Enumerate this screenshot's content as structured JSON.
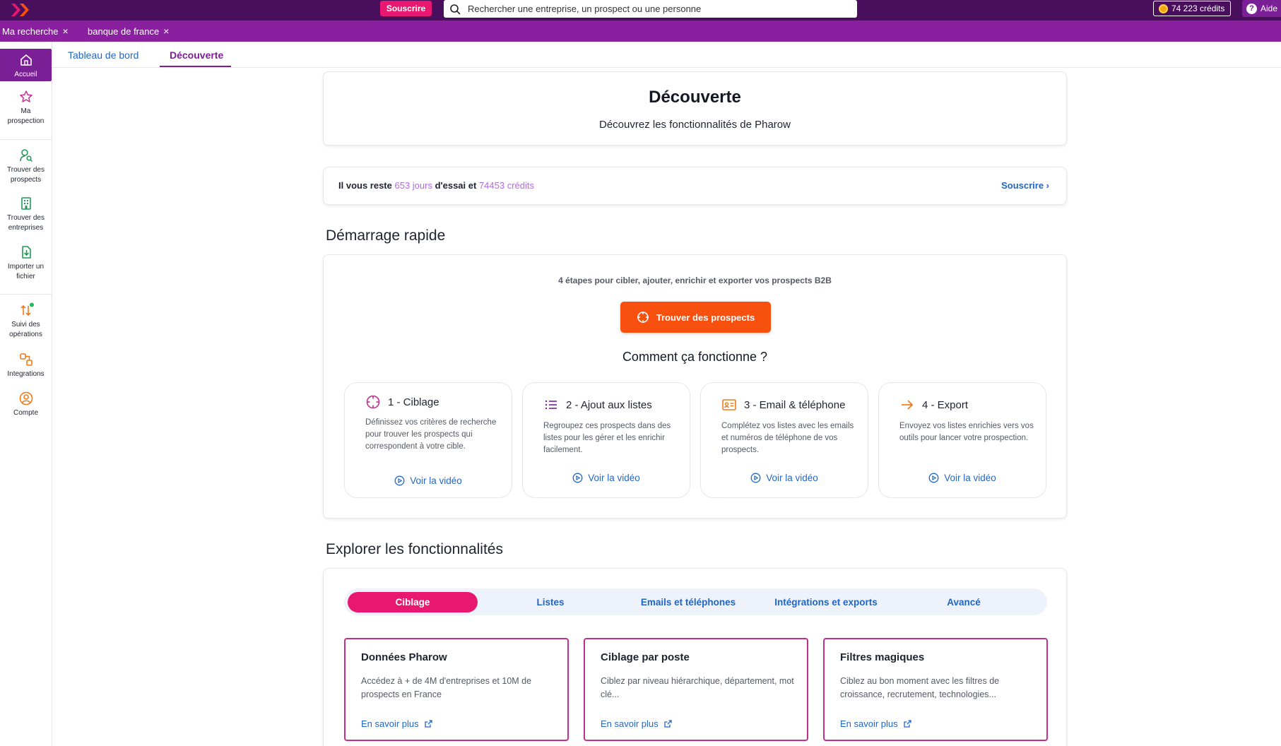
{
  "topbar": {
    "subscribe_label": "Souscrire",
    "search_placeholder": "Rechercher une entreprise, un prospect ou une personne",
    "credits_label": "74 223 crédits",
    "help_label": "Aide"
  },
  "open_tabs": [
    {
      "label": "Ma recherche"
    },
    {
      "label": "banque de france"
    }
  ],
  "sidebar": {
    "items": [
      {
        "label_line1": "Accueil",
        "label_line2": ""
      },
      {
        "label_line1": "Ma",
        "label_line2": "prospection"
      },
      {
        "label_line1": "Trouver des",
        "label_line2": "prospects"
      },
      {
        "label_line1": "Trouver des",
        "label_line2": "entreprises"
      },
      {
        "label_line1": "Importer un",
        "label_line2": "fichier"
      },
      {
        "label_line1": "Suivi des",
        "label_line2": "opérations"
      },
      {
        "label_line1": "Integrations",
        "label_line2": ""
      },
      {
        "label_line1": "Compte",
        "label_line2": ""
      }
    ]
  },
  "subnav": {
    "tabs": [
      {
        "label": "Tableau de bord"
      },
      {
        "label": "Découverte"
      }
    ]
  },
  "hero": {
    "title": "Découverte",
    "subtitle": "Découvrez les fonctionnalités de Pharow"
  },
  "trial": {
    "prefix": "Il vous reste ",
    "days": "653 jours",
    "middle": " d'essai et ",
    "credits": "74453 crédits",
    "link": "Souscrire ›"
  },
  "quickstart": {
    "section_title": "Démarrage rapide",
    "subtitle": "4 étapes pour cibler, ajouter, enrichir et exporter vos prospects B2B",
    "button_label": "Trouver des prospects",
    "how_title": "Comment ça fonctionne ?",
    "steps": [
      {
        "title": "1 - Ciblage",
        "desc": "Définissez vos critères de recherche pour trouver les prospects qui correspondent à votre cible.",
        "link": "Voir la vidéo",
        "icon": "target-icon"
      },
      {
        "title": "2 - Ajout aux listes",
        "desc": "Regroupez ces prospects dans des listes pour les gérer et les enrichir facilement.",
        "link": "Voir la vidéo",
        "icon": "list-icon"
      },
      {
        "title": "3 - Email & téléphone",
        "desc": "Complétez vos listes avec les emails et numéros de téléphone de vos prospects.",
        "link": "Voir la vidéo",
        "icon": "contact-card-icon"
      },
      {
        "title": "4 - Export",
        "desc": "Envoyez vos listes enrichies vers vos outils pour lancer votre prospection.",
        "link": "Voir la vidéo",
        "icon": "arrow-right-icon"
      }
    ]
  },
  "explore": {
    "section_title": "Explorer les fonctionnalités",
    "tabs": [
      {
        "label": "Ciblage"
      },
      {
        "label": "Listes"
      },
      {
        "label": "Emails et téléphones"
      },
      {
        "label": "Intégrations et exports"
      },
      {
        "label": "Avancé"
      }
    ],
    "features": [
      {
        "title": "Données Pharow",
        "desc": "Accédez à + de 4M d'entreprises et 10M de prospects en France",
        "link": "En savoir plus"
      },
      {
        "title": "Ciblage par poste",
        "desc": "Ciblez par niveau hiérarchique, département, mot clé...",
        "link": "En savoir plus"
      },
      {
        "title": "Filtres magiques",
        "desc": "Ciblez au bon moment avec les filtres de croissance, recrutement, technologies...",
        "link": "En savoir plus"
      }
    ]
  },
  "colors": {
    "topbar": "#4a0f5c",
    "tabsbar": "#8a1fa0",
    "accent_purple": "#7a1f95",
    "accent_pink": "#e8176f",
    "cta_orange": "#f8500f",
    "link_blue": "#2166c7",
    "highlight_lilac": "#b06ce0"
  }
}
